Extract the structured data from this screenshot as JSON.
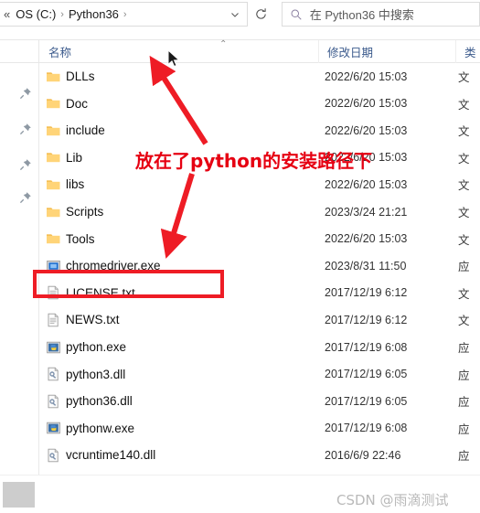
{
  "window": {
    "addressbar": {
      "overflow_indicator": "«",
      "crumbs": [
        "OS (C:)",
        "Python36"
      ],
      "separator": "›",
      "dropdown_icon": "chevron-down-icon",
      "refresh_icon": "refresh-icon"
    },
    "search": {
      "icon": "search-icon",
      "placeholder": "在 Python36 中搜索",
      "value": ""
    }
  },
  "columns": {
    "name": "名称",
    "date_modified": "修改日期",
    "type": "类",
    "sort_caret": "⌃"
  },
  "nav_pane": {
    "pin_icon": "pin-icon",
    "pin_count": 4
  },
  "files": [
    {
      "name": "DLLs",
      "date": "2022/6/20 15:03",
      "type": "文",
      "icon": "folder-icon"
    },
    {
      "name": "Doc",
      "date": "2022/6/20 15:03",
      "type": "文",
      "icon": "folder-icon"
    },
    {
      "name": "include",
      "date": "2022/6/20 15:03",
      "type": "文",
      "icon": "folder-icon"
    },
    {
      "name": "Lib",
      "date": "2022/6/20 15:03",
      "type": "文",
      "icon": "folder-icon"
    },
    {
      "name": "libs",
      "date": "2022/6/20 15:03",
      "type": "文",
      "icon": "folder-icon"
    },
    {
      "name": "Scripts",
      "date": "2023/3/24 21:21",
      "type": "文",
      "icon": "folder-icon"
    },
    {
      "name": "Tools",
      "date": "2022/6/20 15:03",
      "type": "文",
      "icon": "folder-icon"
    },
    {
      "name": "chromedriver.exe",
      "date": "2023/8/31 11:50",
      "type": "应",
      "icon": "exe-console-icon"
    },
    {
      "name": "LICENSE.txt",
      "date": "2017/12/19 6:12",
      "type": "文",
      "icon": "text-file-icon"
    },
    {
      "name": "NEWS.txt",
      "date": "2017/12/19 6:12",
      "type": "文",
      "icon": "text-file-icon"
    },
    {
      "name": "python.exe",
      "date": "2017/12/19 6:08",
      "type": "应",
      "icon": "python-exe-icon"
    },
    {
      "name": "python3.dll",
      "date": "2017/12/19 6:05",
      "type": "应",
      "icon": "dll-file-icon"
    },
    {
      "name": "python36.dll",
      "date": "2017/12/19 6:05",
      "type": "应",
      "icon": "dll-file-icon"
    },
    {
      "name": "pythonw.exe",
      "date": "2017/12/19 6:08",
      "type": "应",
      "icon": "python-exe-icon"
    },
    {
      "name": "vcruntime140.dll",
      "date": "2016/6/9 22:46",
      "type": "应",
      "icon": "dll-file-icon"
    }
  ],
  "annotations": {
    "text": "放在了python的安装路径下",
    "text_color": "#e60012",
    "highlight_color": "#ee1c25",
    "highlighted_file": "chromedriver.exe",
    "arrow_up_name": "red-arrow-up",
    "arrow_down_name": "red-arrow-down"
  },
  "watermark": "CSDN @雨滴测试",
  "theme": {
    "folder": "#ffd071",
    "header_text": "#3b5a8c",
    "accent_red": "#ee1c25"
  }
}
